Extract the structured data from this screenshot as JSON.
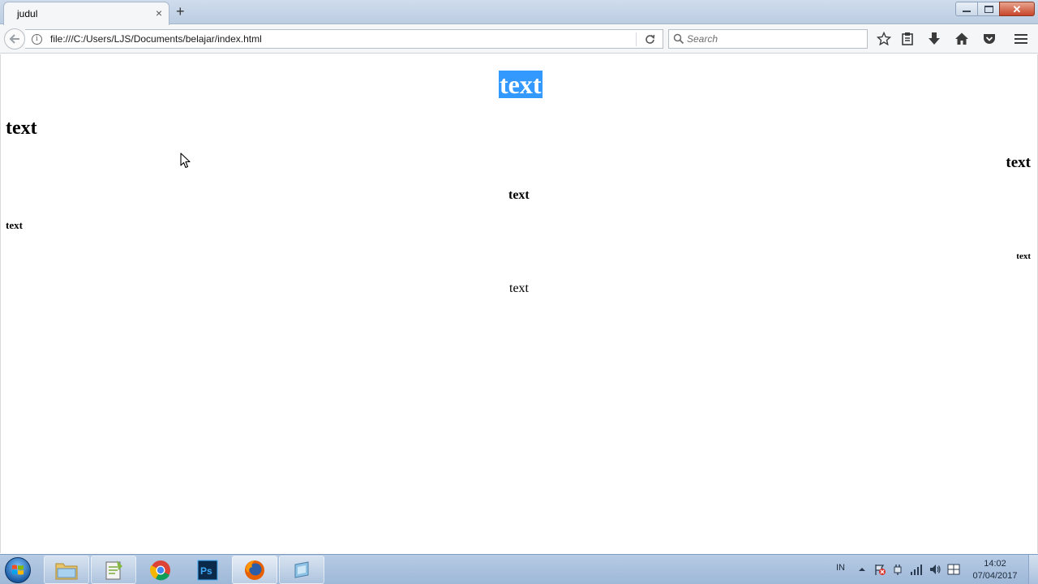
{
  "browser": {
    "tab_title": "judul",
    "tab_close": "×",
    "new_tab": "+",
    "url": "file:///C:/Users/LJS/Documents/belajar/index.html",
    "search_placeholder": "Search",
    "window_close": "✕"
  },
  "page": {
    "h1": "text",
    "h2": "text",
    "h3": "text",
    "h4": "text",
    "h5": "text",
    "h6": "text",
    "paragraph": "text",
    "selection_color": "#3399ff"
  },
  "taskbar": {
    "pinned_apps": [
      "windows-explorer",
      "notepad-plus",
      "google-chrome",
      "photoshop",
      "firefox",
      "window-switcher"
    ],
    "language": "IN",
    "time": "14:02",
    "date": "07/04/2017"
  }
}
